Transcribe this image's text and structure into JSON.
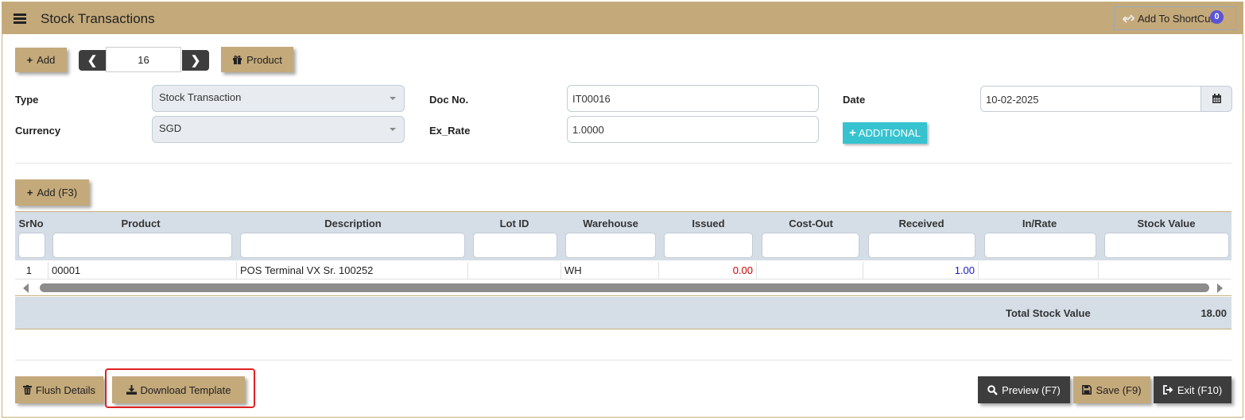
{
  "header": {
    "title": "Stock Transactions",
    "shortcut_label": "Add To ShortCut",
    "shortcut_count": "0"
  },
  "toolbar": {
    "add_label": "Add",
    "pager_value": "16",
    "product_label": "Product"
  },
  "form": {
    "type_label": "Type",
    "type_value": "Stock Transaction",
    "docno_label": "Doc No.",
    "docno_value": "IT00016",
    "date_label": "Date",
    "date_value": "10-02-2025",
    "currency_label": "Currency",
    "currency_value": "SGD",
    "exrate_label": "Ex_Rate",
    "exrate_value": "1.0000",
    "additional_label": "ADDITIONAL"
  },
  "grid": {
    "add_label": "Add (F3)",
    "columns": [
      "SrNo",
      "Product",
      "Description",
      "Lot ID",
      "Warehouse",
      "Issued",
      "Cost-Out",
      "Received",
      "In/Rate",
      "Stock Value"
    ],
    "rows": [
      {
        "srno": "1",
        "product": "00001",
        "description": "POS Terminal VX Sr. 100252",
        "lot_id": "",
        "warehouse": "WH",
        "issued": "0.00",
        "cost_out": "",
        "received": "1.00",
        "in_rate": "",
        "stock_value": ""
      }
    ],
    "total_label": "Total Stock Value",
    "total_value": "18.00"
  },
  "footer": {
    "flush_label": "Flush Details",
    "download_label": "Download Template",
    "preview_label": "Preview (F7)",
    "save_label": "Save (F9)",
    "exit_label": "Exit (F10)"
  },
  "colors": {
    "accent_tan": "#c4a97a",
    "dark_button": "#3d3d3d",
    "additional_teal": "#36c3cf",
    "issued_red": "#cc0000",
    "received_blue": "#1a1acc",
    "highlight_red": "#e0201f"
  }
}
